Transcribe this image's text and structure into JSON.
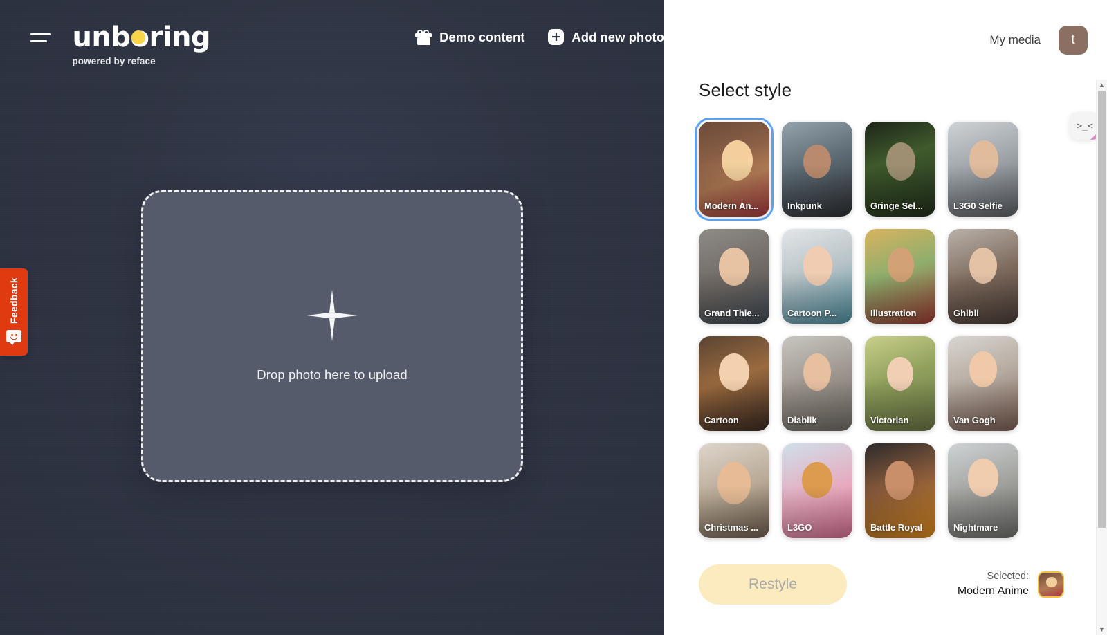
{
  "left": {
    "menu_icon": "hamburger-icon",
    "brand": {
      "name": "unboring",
      "tagline": "powered by reface"
    },
    "actions": [
      {
        "icon": "gift-icon",
        "label": "Demo content"
      },
      {
        "icon": "plus-icon",
        "label": "Add new photo"
      }
    ],
    "dropzone": {
      "label": "Drop photo here to upload",
      "icon": "plus-icon"
    },
    "feedback": {
      "label": "Feedback",
      "icon": "smiley-bubble-icon",
      "color": "#E03A11"
    }
  },
  "right": {
    "my_media_label": "My media",
    "avatar_initial": "t",
    "section_title": "Select style",
    "styles": [
      {
        "label": "Modern An...",
        "art": "t-anime",
        "selected": true
      },
      {
        "label": "Inkpunk",
        "art": "t-inkpunk",
        "selected": false
      },
      {
        "label": "Gringe Sel...",
        "art": "t-gringe",
        "selected": false
      },
      {
        "label": "L3G0 Selfie",
        "art": "t-l3g0s",
        "selected": false
      },
      {
        "label": "Grand Thie...",
        "art": "t-gta",
        "selected": false
      },
      {
        "label": "Cartoon P...",
        "art": "t-cartoonp",
        "selected": false
      },
      {
        "label": "Illustration",
        "art": "t-illu",
        "selected": false
      },
      {
        "label": "Ghibli",
        "art": "t-ghibli",
        "selected": false
      },
      {
        "label": "Cartoon",
        "art": "t-cartoon",
        "selected": false
      },
      {
        "label": "Diablik",
        "art": "t-diablik",
        "selected": false
      },
      {
        "label": "Victorian",
        "art": "t-victor",
        "selected": false
      },
      {
        "label": "Van Gogh",
        "art": "t-vangogh",
        "selected": false
      },
      {
        "label": "Christmas ...",
        "art": "t-xmas",
        "selected": false
      },
      {
        "label": "L3GO",
        "art": "t-l3go",
        "selected": false
      },
      {
        "label": "Battle Royal",
        "art": "t-battle",
        "selected": false
      },
      {
        "label": "Nightmare",
        "art": "t-night",
        "selected": false
      }
    ],
    "restyle_label": "Restyle",
    "selected_label": "Selected:",
    "selected_name": "Modern Anime",
    "float_widget_label": ">_<",
    "scroll_up": "▲",
    "scroll_down": "▼"
  },
  "colors": {
    "left_bg": "#2f3443",
    "dropzone_bg": "#565b6b",
    "brand_dot": "#F9D548",
    "selection_ring": "#5aa0f5",
    "restyle_bg": "#FBEBBE",
    "feedback": "#E03A11",
    "avatar_bg": "#8B6F63",
    "selected_thumb_border": "#F6C445"
  }
}
